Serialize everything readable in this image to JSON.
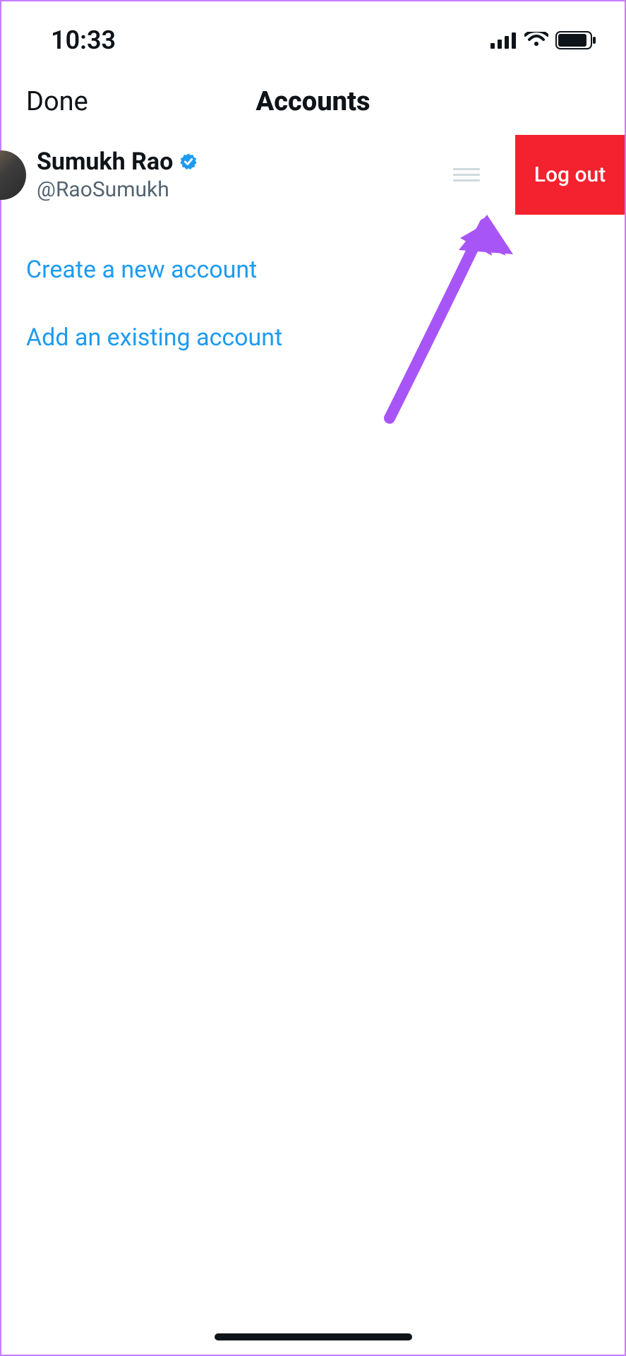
{
  "status_bar": {
    "time": "10:33"
  },
  "nav": {
    "done_label": "Done",
    "title": "Accounts"
  },
  "account": {
    "name": "Sumukh Rao",
    "handle": "@RaoSumukh",
    "logout_label": "Log out"
  },
  "links": {
    "create_account": "Create a new account",
    "add_existing": "Add an existing account"
  },
  "colors": {
    "accent": "#1d9bf0",
    "danger": "#f4212e",
    "verified": "#1d9bf0",
    "annotation": "#a855f7"
  }
}
